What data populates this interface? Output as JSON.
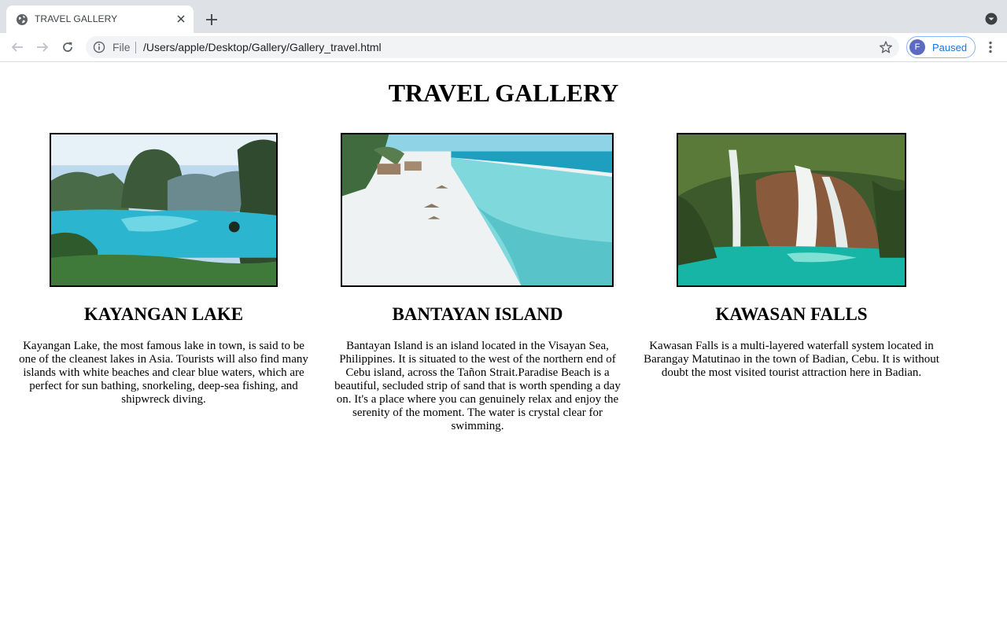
{
  "browser": {
    "tab_title": "TRAVEL GALLERY",
    "omnibox_scheme": "File",
    "url": "/Users/apple/Desktop/Gallery/Gallery_travel.html",
    "profile_initial": "F",
    "profile_status": "Paused",
    "accent_color": "#1a73e8"
  },
  "page": {
    "title": "TRAVEL GALLERY",
    "cards": [
      {
        "title": "KAYANGAN LAKE",
        "description": "Kayangan Lake, the most famous lake in town, is said to be one of the cleanest lakes in Asia. Tourists will also find many islands with white beaches and clear blue waters, which are perfect for sun bathing, snorkeling, deep-sea fishing, and shipwreck diving."
      },
      {
        "title": "BANTAYAN ISLAND",
        "description": "Bantayan Island is an island located in the Visayan Sea, Philippines. It is situated to the west of the northern end of Cebu island, across the Tañon Strait.Paradise Beach is a beautiful, secluded strip of sand that is worth spending a day on. It's a place where you can genuinely relax and enjoy the serenity of the moment. The water is crystal clear for swimming."
      },
      {
        "title": "KAWASAN FALLS",
        "description": "Kawasan Falls is a multi-layered waterfall system located in Barangay Matutinao in the town of Badian, Cebu. It is without doubt the most visited tourist attraction here in Badian."
      }
    ]
  }
}
